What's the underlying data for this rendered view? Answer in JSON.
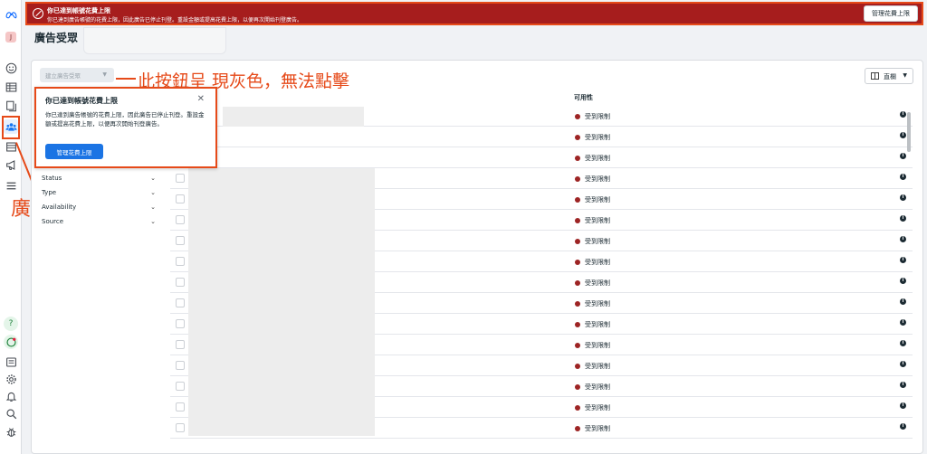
{
  "banner": {
    "title": "你已達到帳號花費上限",
    "body": "你已達到廣告帳號的花費上限，因此廣告已停止刊登。重設金額或提高花費上限，以便再次開始刊登廣告。",
    "button_label": "管理花費上限"
  },
  "page": {
    "title": "廣告受眾"
  },
  "toolbar": {
    "create_label": "建立廣告受眾",
    "columns_label": "直欄"
  },
  "annotations": {
    "button_note": "此按鈕呈 現灰色，無法點擊",
    "rail_note": "廣告受眾"
  },
  "rail": {
    "avatar_letter": "J",
    "icons": [
      "meta-logo",
      "smiley-icon",
      "table-icon",
      "pages-icon",
      "audience-icon",
      "list-icon",
      "megaphone-icon",
      "menu-icon",
      "help-icon",
      "feedback-icon",
      "news-icon",
      "settings-icon",
      "bell-icon",
      "search-icon",
      "bug-icon"
    ]
  },
  "popover": {
    "title": "你已達到帳號花費上限",
    "body": "你已達到廣告帳號的花費上限，因此廣告已停止刊登。重設金額或提高花費上限，以便再次開始刊登廣告。",
    "button_label": "管理花費上限"
  },
  "filters": [
    "Status",
    "Type",
    "Availability",
    "Source"
  ],
  "table": {
    "column_availability": "可用性",
    "rows": [
      {
        "status": "受到限制"
      },
      {
        "status": "受到限制"
      },
      {
        "status": "受到限制"
      },
      {
        "status": "受到限制"
      },
      {
        "status": "受到限制"
      },
      {
        "status": "受到限制"
      },
      {
        "status": "受到限制"
      },
      {
        "status": "受到限制"
      },
      {
        "status": "受到限制"
      },
      {
        "status": "受到限制"
      },
      {
        "status": "受到限制"
      },
      {
        "status": "受到限制"
      },
      {
        "status": "受到限制"
      },
      {
        "status": "受到限制"
      },
      {
        "status": "受到限制"
      },
      {
        "status": "受到限制"
      }
    ]
  },
  "colors": {
    "banner_bg": "#a61d1d",
    "annotation": "#e64a19",
    "primary": "#1b74e4",
    "status_dot": "#9d2424"
  }
}
